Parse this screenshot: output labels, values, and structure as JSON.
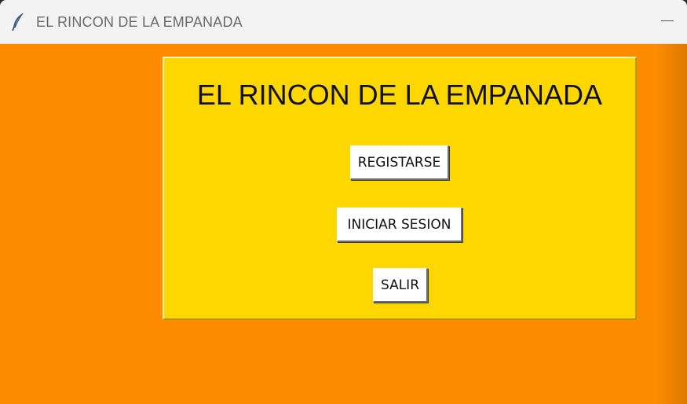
{
  "window": {
    "title": "EL RINCON DE LA EMPANADA",
    "app_icon": "feather-icon",
    "controls": {
      "minimize": "minimize-icon"
    }
  },
  "main": {
    "heading": "EL RINCON DE LA EMPANADA",
    "buttons": {
      "register_label": "REGISTARSE",
      "login_label": "INICIAR SESION",
      "exit_label": "SALIR"
    }
  },
  "colors": {
    "background": "#ff8c00",
    "panel": "#ffd700",
    "button": "#ffffff",
    "titlebar": "#f3f3f3"
  }
}
